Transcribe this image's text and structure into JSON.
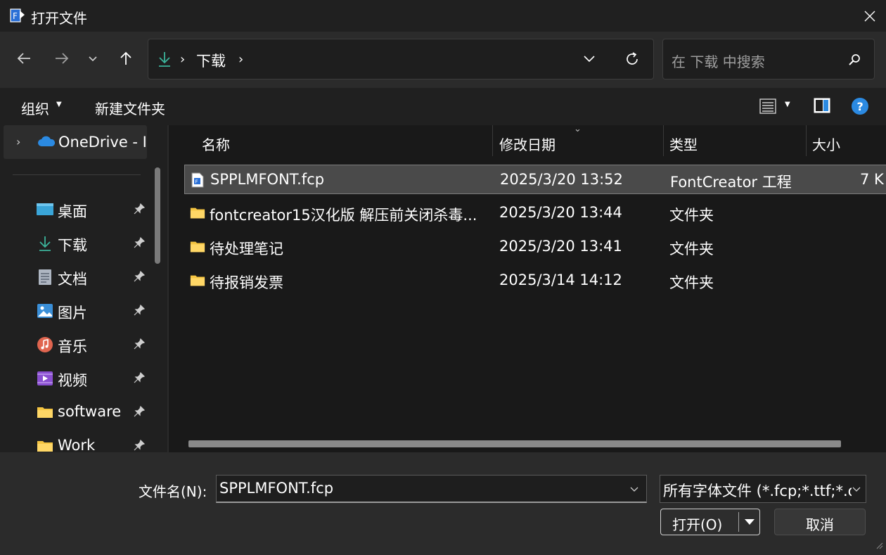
{
  "window": {
    "title": "打开文件"
  },
  "nav": {
    "breadcrumb": "下载",
    "search_placeholder": "在 下载 中搜索"
  },
  "toolbar": {
    "organize": "组织",
    "new_folder": "新建文件夹"
  },
  "sidebar": {
    "onedrive": "OneDrive - I",
    "items": [
      {
        "label": "桌面",
        "icon": "desktop-icon"
      },
      {
        "label": "下载",
        "icon": "download-icon"
      },
      {
        "label": "文档",
        "icon": "document-icon"
      },
      {
        "label": "图片",
        "icon": "pictures-icon"
      },
      {
        "label": "音乐",
        "icon": "music-icon"
      },
      {
        "label": "视频",
        "icon": "videos-icon"
      },
      {
        "label": "software",
        "icon": "folder-icon"
      },
      {
        "label": "Work",
        "icon": "folder-icon"
      }
    ]
  },
  "columns": {
    "name": "名称",
    "date": "修改日期",
    "type": "类型",
    "size": "大小"
  },
  "files": [
    {
      "name": "SPPLMFONT.fcp",
      "date": "2025/3/20 13:52",
      "type": "FontCreator 工程",
      "size": "7 K",
      "selected": true
    },
    {
      "name": "fontcreator15汉化版 解压前关闭杀毒...",
      "date": "2025/3/20 13:44",
      "type": "文件夹",
      "size": ""
    },
    {
      "name": "待处理笔记",
      "date": "2025/3/20 13:41",
      "type": "文件夹",
      "size": ""
    },
    {
      "name": "待报销发票",
      "date": "2025/3/14 14:12",
      "type": "文件夹",
      "size": ""
    }
  ],
  "footer": {
    "filename_label": "文件名(N):",
    "filename_value": "SPPLMFONT.fcp",
    "filter_value": "所有字体文件 (*.fcp;*.ttf;*.otf",
    "open_label": "打开(O)",
    "cancel_label": "取消"
  },
  "colors": {
    "background": "#202020",
    "accent_download": "#3bb39a",
    "folder": "#f5c542",
    "help": "#2b8ae2"
  }
}
